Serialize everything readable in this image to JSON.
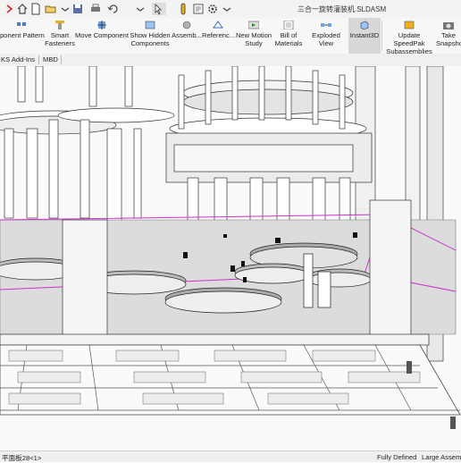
{
  "window": {
    "title": "三合一旋转灌装机.SLDASM"
  },
  "quick_access": [
    {
      "name": "menu-chevron-icon",
      "glyph": "❯"
    },
    {
      "name": "home-icon"
    },
    {
      "name": "new-document-icon"
    },
    {
      "name": "open-folder-icon"
    },
    {
      "name": "save-icon"
    },
    {
      "name": "print-icon"
    },
    {
      "name": "undo-icon"
    },
    {
      "name": "select-arrow-icon"
    },
    {
      "name": "rebuild-icon"
    },
    {
      "name": "file-properties-icon"
    },
    {
      "name": "options-gear-icon"
    }
  ],
  "ribbon": {
    "buttons": [
      {
        "id": "component-pattern",
        "label1": "ponent Pattern",
        "label2": "",
        "icon": "pattern-icon"
      },
      {
        "id": "smart-fasteners",
        "label1": "Smart",
        "label2": "Fasteners",
        "icon": "fastener-icon"
      },
      {
        "id": "move-component",
        "label1": "Move Component",
        "label2": "",
        "icon": "move-component-icon"
      },
      {
        "id": "show-hidden",
        "label1": "Show Hidden",
        "label2": "Components",
        "icon": "show-hidden-icon"
      },
      {
        "id": "assembly-features",
        "label1": "Assemb...",
        "label2": "",
        "icon": "assembly-features-icon"
      },
      {
        "id": "reference-geometry",
        "label1": "Referenc...",
        "label2": "",
        "icon": "reference-geometry-icon"
      },
      {
        "id": "new-motion-study",
        "label1": "New Motion",
        "label2": "Study",
        "icon": "motion-study-icon"
      },
      {
        "id": "bill-of-materials",
        "label1": "Bill of",
        "label2": "Materials",
        "icon": "bom-icon"
      },
      {
        "id": "exploded-view",
        "label1": "Exploded View",
        "label2": "",
        "icon": "exploded-view-icon"
      },
      {
        "id": "instant3d",
        "label1": "Instant3D",
        "label2": "",
        "icon": "instant3d-icon",
        "active": true
      },
      {
        "id": "update-speedpak",
        "label1": "Update SpeedPak",
        "label2": "Subassemblies",
        "icon": "speedpak-icon"
      },
      {
        "id": "take-snapshot",
        "label1": "Take",
        "label2": "Snapsho",
        "icon": "snapshot-icon"
      }
    ]
  },
  "tabs": {
    "addins": "KS Add-Ins",
    "mbd": "MBD"
  },
  "status": {
    "left": "平面板28<1>",
    "state": "Fully Defined",
    "mode": "Large Assemb"
  },
  "colors": {
    "accent": "#cc33cc",
    "active_button": "#d8d8d8",
    "ribbon_bg": "#f7f7f7",
    "viewport_bg": "#fafafa",
    "gray_panel": "#dcdcdc"
  }
}
